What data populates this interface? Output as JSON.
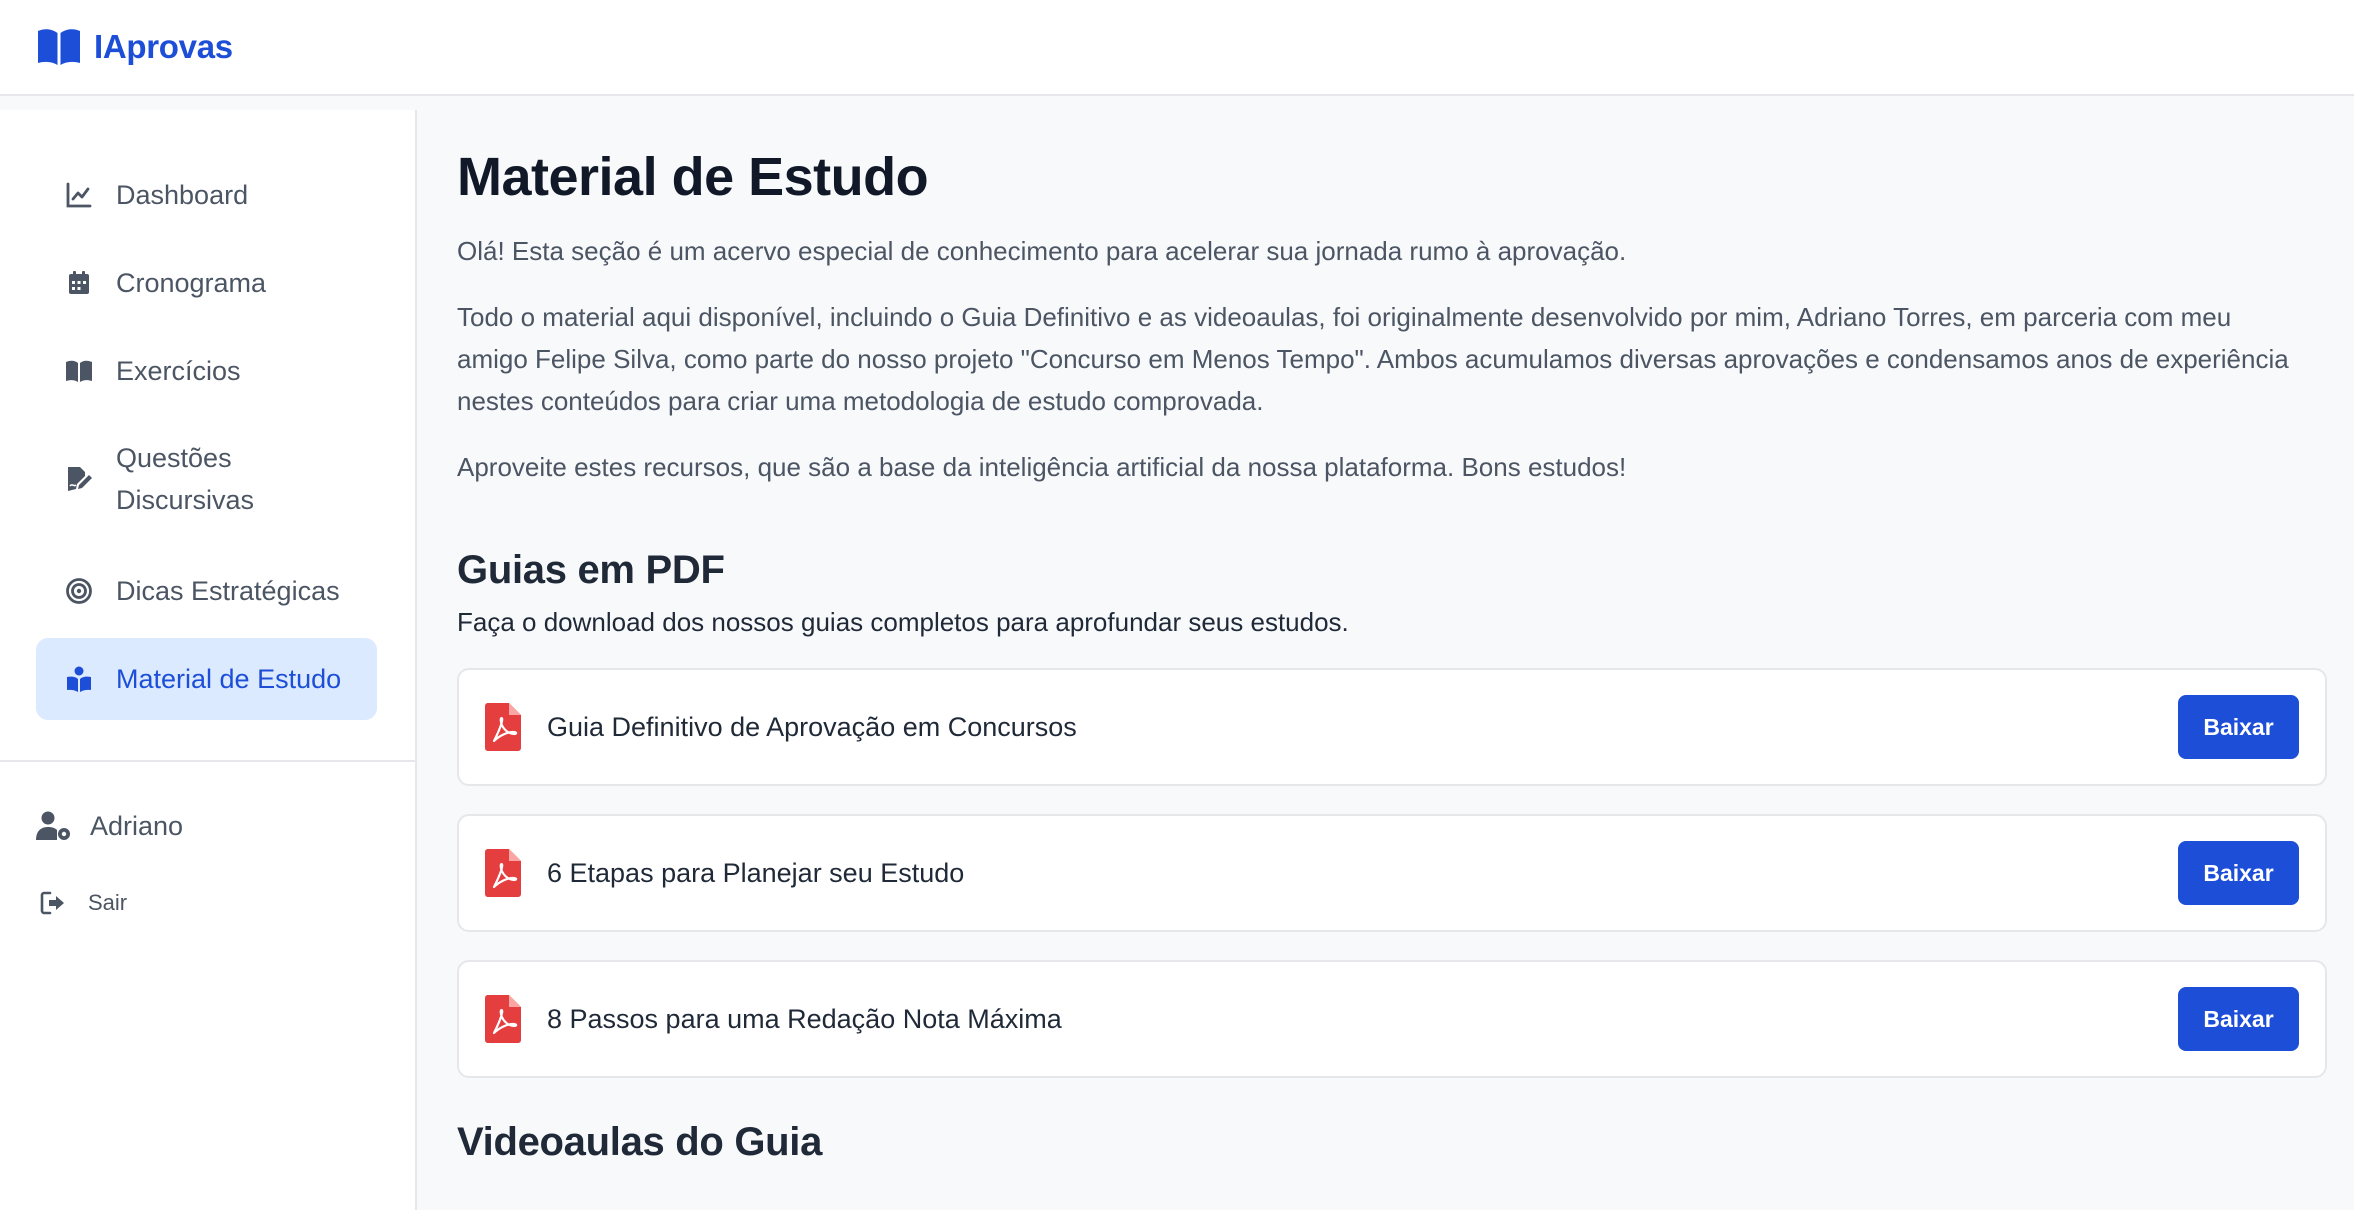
{
  "brand": {
    "name": "IAprovas",
    "icon": "book-open-icon",
    "color": "#1d4ed8"
  },
  "sidebar": {
    "items": [
      {
        "label": "Dashboard",
        "icon": "chart-line-icon",
        "active": false
      },
      {
        "label": "Cronograma",
        "icon": "calendar-icon",
        "active": false
      },
      {
        "label": "Exercícios",
        "icon": "book-open-icon",
        "active": false
      },
      {
        "label": "Questões Discursivas",
        "icon": "file-signature-icon",
        "active": false
      },
      {
        "label": "Dicas Estratégicas",
        "icon": "target-icon",
        "active": false
      },
      {
        "label": "Material de Estudo",
        "icon": "book-reader-icon",
        "active": true
      }
    ],
    "user": {
      "name": "Adriano",
      "icon": "user-gear-icon"
    },
    "logout": {
      "label": "Sair",
      "icon": "sign-out-icon"
    }
  },
  "main": {
    "title": "Material de Estudo",
    "intro": "Olá! Esta seção é um acervo especial de conhecimento para acelerar sua jornada rumo à aprovação.",
    "paragraph": "Todo o material aqui disponível, incluindo o Guia Definitivo e as videoaulas, foi originalmente desenvolvido por mim, Adriano Torres, em parceria com meu amigo Felipe Silva, como parte do nosso projeto \"Concurso em Menos Tempo\". Ambos acumulamos diversas aprovações e condensamos anos de experiência nestes conteúdos para criar uma metodologia de estudo comprovada.",
    "closing": "Aproveite estes recursos, que são a base da inteligência artificial da nossa plataforma. Bons estudos!",
    "pdf_section": {
      "title": "Guias em PDF",
      "subtitle": "Faça o download dos nossos guias completos para aprofundar seus estudos.",
      "items": [
        {
          "title": "Guia Definitivo de Aprovação em Concursos",
          "button": "Baixar",
          "icon": "file-pdf-icon"
        },
        {
          "title": "6 Etapas para Planejar seu Estudo",
          "button": "Baixar",
          "icon": "file-pdf-icon"
        },
        {
          "title": "8 Passos para uma Redação Nota Máxima",
          "button": "Baixar",
          "icon": "file-pdf-icon"
        }
      ]
    },
    "video_section": {
      "title": "Videoaulas do Guia"
    }
  },
  "colors": {
    "accent": "#1d4ed8",
    "active_bg": "#dbeafe",
    "pdf_red": "#e53e3e"
  }
}
